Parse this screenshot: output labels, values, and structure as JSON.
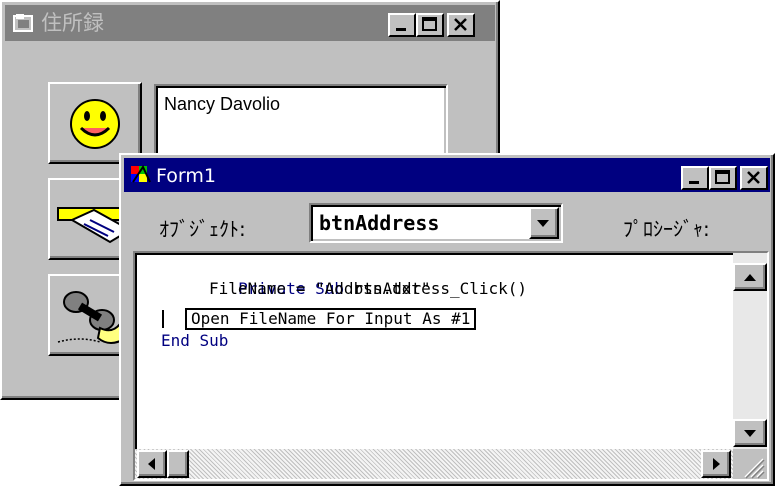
{
  "address_window": {
    "title": "住所録",
    "title_icon": "app-window-icon",
    "title_buttons": [
      "minimize-icon",
      "maximize-icon",
      "close-icon"
    ],
    "tool_buttons": [
      {
        "icon": "smiley-face-icon"
      },
      {
        "icon": "card-swipe-icon"
      },
      {
        "icon": "telephone-icon"
      }
    ],
    "name_value": "Nancy Davolio"
  },
  "code_window": {
    "title": "Form1",
    "title_icon": "vb-form-icon",
    "title_buttons": [
      "minimize-icon",
      "maximize-icon",
      "close-icon"
    ],
    "object_label": "ｵﾌﾞｼﾞｪｸﾄ:",
    "object_value": "btnAddress",
    "procedure_label": "ﾌﾟﾛｼｰｼﾞｬ:",
    "code": {
      "line1_kw": "Private Sub",
      "line1_rest": " btnAddress_Click()",
      "line2": "FileName = \"Addrss.txt\"",
      "line3": "Open FileName For Input As #1",
      "line4": "End Sub"
    }
  },
  "colors": {
    "face": "#c0c0c0",
    "active_title": "#000080",
    "inactive_title": "#808080",
    "keyword": "#000080",
    "smiley": "#ffff00"
  }
}
